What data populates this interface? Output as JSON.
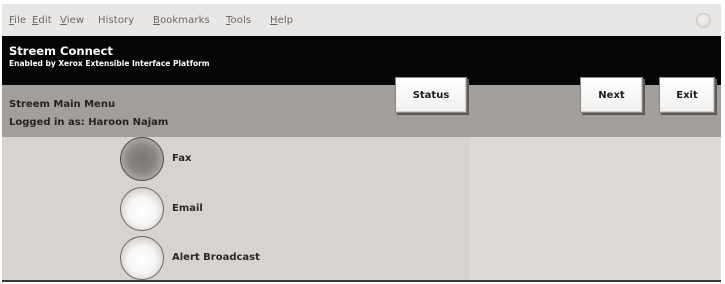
{
  "browser": {
    "menus": [
      {
        "mnemonic": "F",
        "rest": "ile"
      },
      {
        "mnemonic": "E",
        "rest": "dit"
      },
      {
        "mnemonic": "V",
        "rest": "iew"
      },
      {
        "mnemonic": "",
        "rest": "History"
      },
      {
        "mnemonic": "B",
        "rest": "ookmarks"
      },
      {
        "mnemonic": "T",
        "rest": "ools"
      },
      {
        "mnemonic": "H",
        "rest": "elp"
      }
    ]
  },
  "header": {
    "title": "Streem Connect",
    "subtitle": "Enabled by Xerox Extensible Interface Platform"
  },
  "infobar": {
    "menu_title": "Streem Main Menu",
    "logged_in": "Logged in as: Haroon Najam",
    "buttons": {
      "status": "Status",
      "next": "Next",
      "exit": "Exit"
    }
  },
  "options": [
    {
      "label": "Fax",
      "selected": true
    },
    {
      "label": "Email",
      "selected": false
    },
    {
      "label": "Alert Broadcast",
      "selected": false
    }
  ]
}
